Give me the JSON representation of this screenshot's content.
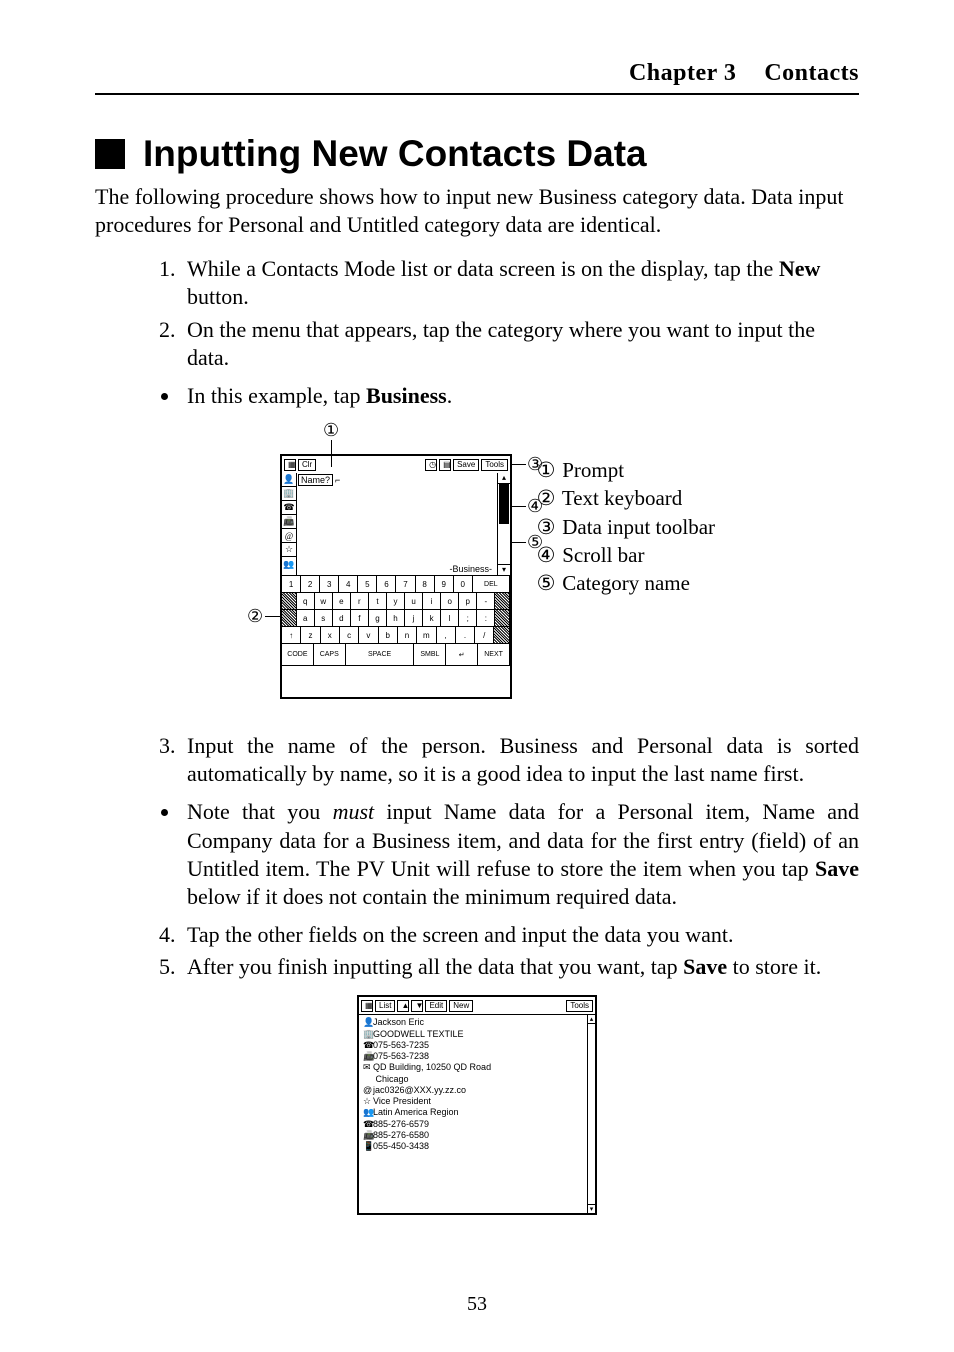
{
  "header": {
    "chapter": "Chapter 3",
    "title": "Contacts"
  },
  "section_title": "Inputting New Contacts Data",
  "lead": "The following procedure shows how to input new Business category data. Data input procedures for Personal and Untitled category data are identical.",
  "steps_a": {
    "s1_pre": "While a Contacts Mode list or data screen is on the display, tap the ",
    "s1_bold": "New",
    "s1_post": " button.",
    "s2": "On the menu that appears, tap the category where you want to input the data.",
    "note_pre": "In this example, tap ",
    "note_bold": "Business",
    "note_post": "."
  },
  "figure1": {
    "toolbar": {
      "clr": "Clr",
      "save": "Save",
      "tools": "Tools"
    },
    "name_prompt": "Name?",
    "category": "-Business-",
    "keyboard": {
      "row1": [
        "1",
        "2",
        "3",
        "4",
        "5",
        "6",
        "7",
        "8",
        "9",
        "0"
      ],
      "row1_del": "DEL",
      "row2": [
        "q",
        "w",
        "e",
        "r",
        "t",
        "y",
        "u",
        "i",
        "o",
        "p"
      ],
      "row2_extra": "-",
      "row3": [
        "a",
        "s",
        "d",
        "f",
        "g",
        "h",
        "j",
        "k",
        "l",
        ";",
        ":"
      ],
      "row4": [
        "z",
        "x",
        "c",
        "v",
        "b",
        "n",
        "m",
        ",",
        ".",
        "/"
      ],
      "row4_shift": "↑",
      "row5": [
        "CODE",
        "CAPS",
        "SPACE",
        "SMBL",
        "↵",
        "NEXT"
      ]
    },
    "callouts": {
      "c1": "①",
      "c2": "②",
      "c3": "③",
      "c4": "④",
      "c5": "⑤"
    },
    "legend": {
      "l1_num": "①",
      "l1": "Prompt",
      "l2_num": "②",
      "l2": "Text keyboard",
      "l3_num": "③",
      "l3": "Data input toolbar",
      "l4_num": "④",
      "l4": "Scroll bar",
      "l5_num": "⑤",
      "l5": "Category name"
    }
  },
  "steps_b": {
    "s3": "Input the name of the person. Business and Personal data is sorted automatically by name, so it is a good idea to input the last name first.",
    "note2_pre": "Note that you ",
    "note2_ital": "must",
    "note2_mid": " input Name data for a Personal item, Name and Company data for a Business item, and data for the first entry (field) of an Untitled item. The PV Unit will refuse to store the item when you tap ",
    "note2_bold": "Save",
    "note2_post": " below if it does not contain the minimum required data.",
    "s4": "Tap the other fields on the screen and input the data you want.",
    "s5_pre": "After you finish inputting all the data that you want, tap ",
    "s5_bold": "Save",
    "s5_post": " to store it."
  },
  "figure2": {
    "toolbar": {
      "list": "List",
      "up": "▲",
      "down": "▼",
      "edit": "Edit",
      "new": "New",
      "tools": "Tools"
    },
    "rows": [
      {
        "icon": "👤",
        "text": "Jackson Eric"
      },
      {
        "icon": "🏢",
        "text": "GOODWELL TEXTILE"
      },
      {
        "icon": "☎",
        "text": "075-563-7235"
      },
      {
        "icon": "📠",
        "text": "075-563-7238"
      },
      {
        "icon": "✉",
        "text": "QD Building, 10250 QD Road"
      },
      {
        "icon": "",
        "text": "  Chicago"
      },
      {
        "icon": "@",
        "text": "jac0326@XXX.yy.zz.co"
      },
      {
        "icon": "☆",
        "text": "Vice President"
      },
      {
        "icon": "👥",
        "text": "Latin America Region"
      },
      {
        "icon": "☎",
        "text": "885-276-6579"
      },
      {
        "icon": "📠",
        "text": "885-276-6580"
      },
      {
        "icon": "📱",
        "text": "055-450-3438"
      }
    ]
  },
  "page_number": "53"
}
